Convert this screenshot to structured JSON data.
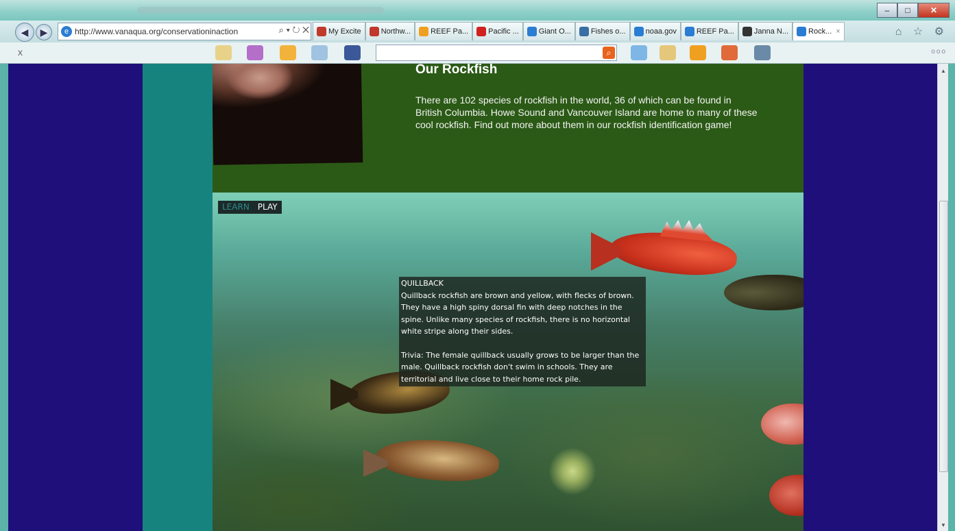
{
  "browser": {
    "window_controls": [
      "–",
      "□",
      "✕"
    ],
    "address_url": "http://www.vanaqua.org/conservationinaction",
    "address_controls": "⌕ ▾ ↻ ✕",
    "tabs": [
      {
        "label": "My Excite",
        "color": "#c0392b"
      },
      {
        "label": "Northw...",
        "color": "#c0392b"
      },
      {
        "label": "REEF Pa...",
        "color": "#f0a020"
      },
      {
        "label": "Pacific ...",
        "color": "#d02020"
      },
      {
        "label": "Giant O...",
        "color": "#2b7cd3"
      },
      {
        "label": "Fishes o...",
        "color": "#3a6ea5"
      },
      {
        "label": "noaa.gov",
        "color": "#2b7cd3"
      },
      {
        "label": "REEF Pa...",
        "color": "#2b7cd3"
      },
      {
        "label": "Janna N...",
        "color": "#333333"
      },
      {
        "label": "Rock...",
        "color": "#2b7cd3",
        "active": true
      }
    ],
    "right_icons": "⌂ ☆ ⚙",
    "toolbar_close": "x",
    "toolbar_dots": "ooo"
  },
  "content": {
    "title": "Our Rockfish",
    "text": "There are 102 species of rockfish in the world, 36 of which can be found in British Columbia. Howe Sound and Vancouver Island are home to many of these cool rockfish. Find out more about them in our rockfish identification game!"
  },
  "game": {
    "tabs": {
      "learn": "LEARN",
      "play": "PLAY"
    },
    "info": {
      "heading": "QUILLBACK",
      "description": "Quillback rockfish are brown and yellow, with flecks of brown. They have a high spiny dorsal fin with deep notches in the spine. Unlike many species of rockfish, there is no horizontal white stripe along their sides.",
      "trivia": "Trivia: The female quillback usually grows to be larger than the male. Quillback rockfish don't swim in schools. They are territorial and live close to their home rock pile."
    }
  }
}
